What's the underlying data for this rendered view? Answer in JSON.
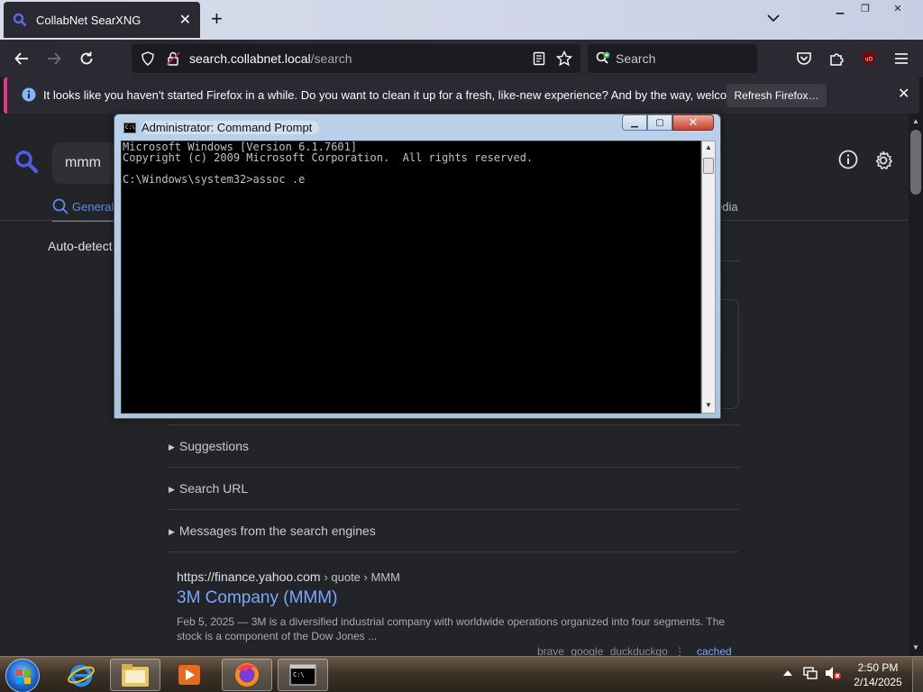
{
  "browser": {
    "tab_title": "CollabNet SearXNG",
    "url_host": "search.collabnet.local",
    "url_path": "/search",
    "search_placeholder": "Search",
    "notification_text": "It looks like you haven't started Firefox in a while. Do you want to clean it up for a fresh, like-new experience? And by the way, welcome back!",
    "notification_button": "Refresh Firefox…",
    "accent": "#e8378a"
  },
  "searx": {
    "query": "mmm",
    "tab_general": "General",
    "tab_media_partial": "edia",
    "language": "Auto-detect",
    "suggestions": "Suggestions",
    "search_url": "Search URL",
    "messages": "Messages from the search engines",
    "result": {
      "url": "https://finance.yahoo.com",
      "breadcrumb": "› quote › MMM",
      "title": "3M Company (MMM)",
      "snippet": "Feb 5, 2025 — 3M is a diversified industrial company with worldwide operations organized into four segments. The stock is a component of the Dow Jones ...",
      "engines": "brave google duckduckgo",
      "engine_sep": "⋮",
      "cached": "cached"
    },
    "link_color": "#7aa7ff"
  },
  "cmd": {
    "title": "Administrator: Command Prompt",
    "lines": [
      "Microsoft Windows [Version 6.1.7601]",
      "Copyright (c) 2009 Microsoft Corporation.  All rights reserved.",
      "",
      "C:\\Windows\\system32>assoc .e"
    ]
  },
  "taskbar": {
    "time": "2:50 PM",
    "date": "2/14/2025"
  }
}
